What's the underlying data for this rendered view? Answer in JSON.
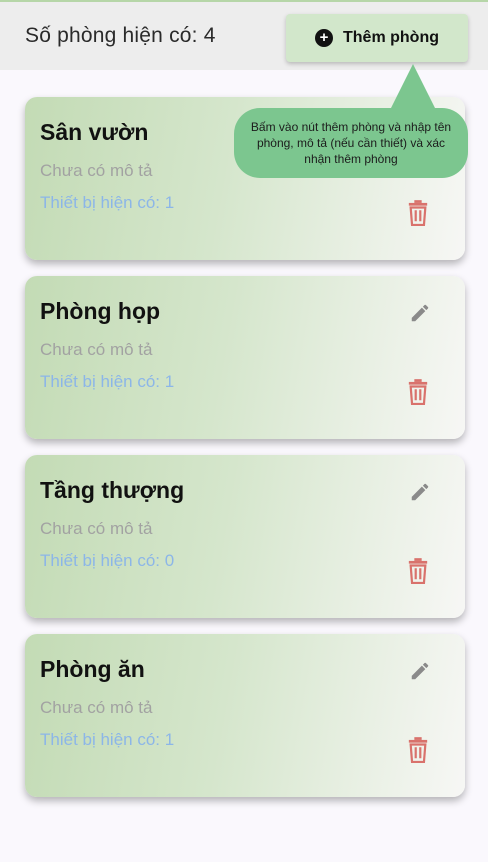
{
  "header": {
    "count_label": "Số phòng hiện có: 4",
    "add_button_label": "Thêm phòng"
  },
  "tooltip": {
    "text": "Bấm vào nút thêm phòng và nhập tên phòng, mô tả (nếu cần thiết) và xác nhận thêm phòng"
  },
  "rooms": [
    {
      "name": "Sân vườn",
      "description": "Chưa có mô tả",
      "devices": "Thiết bị hiện có: 1"
    },
    {
      "name": "Phòng họp",
      "description": "Chưa có mô tả",
      "devices": "Thiết bị hiện có: 1"
    },
    {
      "name": "Tầng thượng",
      "description": "Chưa có mô tả",
      "devices": "Thiết bị hiện có: 0"
    },
    {
      "name": "Phòng ăn",
      "description": "Chưa có mô tả",
      "devices": "Thiết bị hiện có: 1"
    }
  ],
  "colors": {
    "card_gradient_start": "#c3dbb5",
    "add_button_bg": "#d2e7cb",
    "tooltip_bg": "#7cc68f",
    "devices_text": "#8cb6e8",
    "delete_icon": "#d9726c",
    "edit_icon": "#8a8a8a"
  },
  "icons": {
    "add": "plus-circle-icon",
    "edit": "pencil-icon",
    "delete": "trash-icon"
  }
}
